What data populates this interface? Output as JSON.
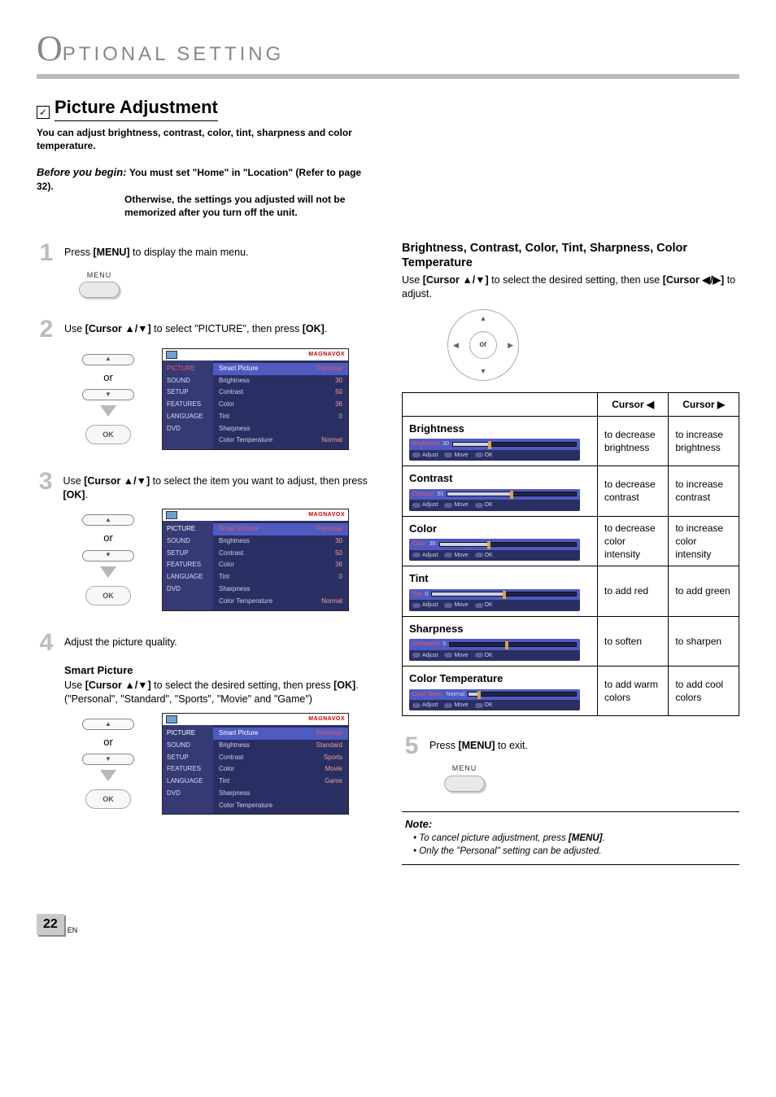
{
  "header": {
    "big_letter": "O",
    "rest": "PTIONAL  SETTING"
  },
  "section": {
    "checkmark": "✓",
    "title": "Picture Adjustment",
    "intro": "You can adjust brightness, contrast, color, tint, sharpness and color temperature.",
    "before_lead": "Before you begin:",
    "before_l1": "You must set \"Home\" in \"Location\" (Refer to page 32).",
    "before_l2": "Otherwise, the settings you adjusted will not be",
    "before_l3": "memorized after you turn off the unit."
  },
  "nav": {
    "or": "or",
    "ok": "OK",
    "up": "▲",
    "down": "▼",
    "left": "◀",
    "right": "▶"
  },
  "menu_btn": {
    "label": "MENU"
  },
  "steps": {
    "s1": {
      "n": "1",
      "text_a": "Press ",
      "text_b": "[MENU]",
      "text_c": " to display the main menu."
    },
    "s2": {
      "n": "2",
      "text_a": "Use ",
      "text_b": "[Cursor ▲/▼]",
      "text_c": " to select \"PICTURE\", then press ",
      "text_d": "[OK]",
      "text_e": "."
    },
    "s3": {
      "n": "3",
      "text_a": "Use ",
      "text_b": "[Cursor ▲/▼]",
      "text_c": " to select the item you want to adjust, then press ",
      "text_d": "[OK]",
      "text_e": "."
    },
    "s4": {
      "n": "4",
      "text": "Adjust the picture quality."
    },
    "smart": {
      "title": "Smart Picture",
      "l1a": "Use ",
      "l1b": "[Cursor ▲/▼]",
      "l1c": " to select the desired setting, then press ",
      "l1d": "[OK]",
      "l1e": ".",
      "options": "(\"Personal\", \"Standard\", \"Sports\", \"Movie\" and \"Game\")"
    },
    "s5": {
      "n": "5",
      "text_a": "Press ",
      "text_b": "[MENU]",
      "text_c": " to exit."
    }
  },
  "osd": {
    "brand": "MAGNAVOX",
    "side": [
      "PICTURE",
      "SOUND",
      "SETUP",
      "FEATURES",
      "LANGUAGE",
      "DVD"
    ],
    "main": [
      {
        "k": "Smart Picture",
        "v": "Personal"
      },
      {
        "k": "Brightness",
        "v": "30"
      },
      {
        "k": "Contrast",
        "v": "50"
      },
      {
        "k": "Color",
        "v": "36"
      },
      {
        "k": "Tint",
        "v": "0"
      },
      {
        "k": "Sharpness",
        "v": ""
      },
      {
        "k": "Color Temperature",
        "v": "Normal"
      }
    ],
    "smart_opts": [
      "Personal",
      "Standard",
      "Sports",
      "Movie",
      "Game"
    ]
  },
  "right": {
    "heading": "Brightness, Contrast, Color, Tint, Sharpness, Color Temperature",
    "l1a": "Use ",
    "l1b": "[Cursor ▲/▼]",
    "l1c": " to select the desired setting, then use ",
    "l1d": "[Cursor ◀/▶]",
    "l1e": " to adjust."
  },
  "table": {
    "head_left": "Cursor ◀",
    "head_right": "Cursor ▶",
    "rows": [
      {
        "name": "Brightness",
        "val": "30",
        "fill": 30,
        "left": "to decrease brightness",
        "right": "to increase brightness"
      },
      {
        "name": "Contrast",
        "val": "50",
        "fill": 50,
        "left": "to decrease contrast",
        "right": "to increase contrast"
      },
      {
        "name": "Color",
        "val": "36",
        "fill": 36,
        "left": "to decrease color intensity",
        "right": "to increase color intensity"
      },
      {
        "name": "Tint",
        "val": "0",
        "fill": 50,
        "left": "to add red",
        "right": "to add green"
      },
      {
        "name": "Sharpness",
        "val": "0",
        "fill": 45,
        "left": "to soften",
        "right": "to sharpen",
        "sharp": true
      },
      {
        "name": "Color Temperature",
        "val": "Normal",
        "fill": 10,
        "left": "to add warm colors",
        "right": "to add cool colors",
        "label_prefix": "Color Temp."
      }
    ],
    "adjust": "Adjust",
    "move": "Move",
    "ok": "OK"
  },
  "note": {
    "title": "Note:",
    "items": [
      {
        "a": "To cancel picture adjustment, press ",
        "b": "[MENU]",
        "c": "."
      },
      {
        "a": "Only the \"Personal\" setting can be adjusted.",
        "b": "",
        "c": ""
      }
    ]
  },
  "page": {
    "num": "22",
    "lang": "EN"
  }
}
